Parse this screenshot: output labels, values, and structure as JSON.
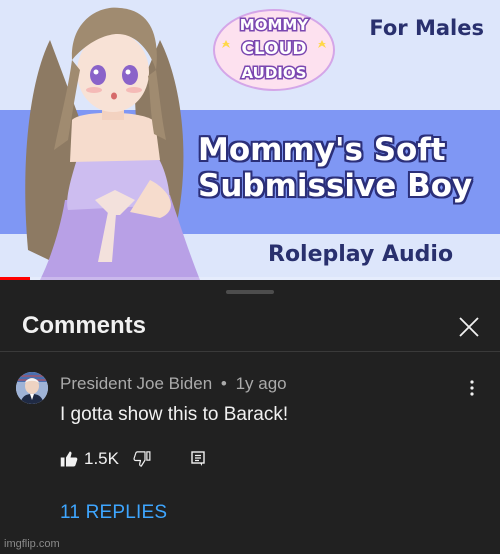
{
  "thumbnail": {
    "logo_lines": [
      "MOMMY",
      "CLOUD",
      "AUDIOS"
    ],
    "tag": "For Males",
    "title_line1": "Mommy's Soft",
    "title_line2": "Submissive Boy",
    "subtitle": "Roleplay Audio",
    "progress": 0.06,
    "colors": {
      "band": "#7f97f4",
      "background": "#dde6fb",
      "text_dark": "#29306e",
      "progress": "#ff0000"
    }
  },
  "comments_panel": {
    "heading": "Comments",
    "close_icon": "close-icon"
  },
  "comment": {
    "author": "President Joe Biden",
    "separator": "•",
    "time": "1y ago",
    "text": "I gotta show this to Barack!",
    "likes": "1.5K",
    "replies_label": "11 REPLIES",
    "icons": [
      "thumbs-up-icon",
      "thumbs-down-icon",
      "reply-icon",
      "more-vert-icon"
    ],
    "colors": {
      "link": "#3ea6ff",
      "meta": "#aaaaaa"
    }
  },
  "watermark": "imgflip.com"
}
